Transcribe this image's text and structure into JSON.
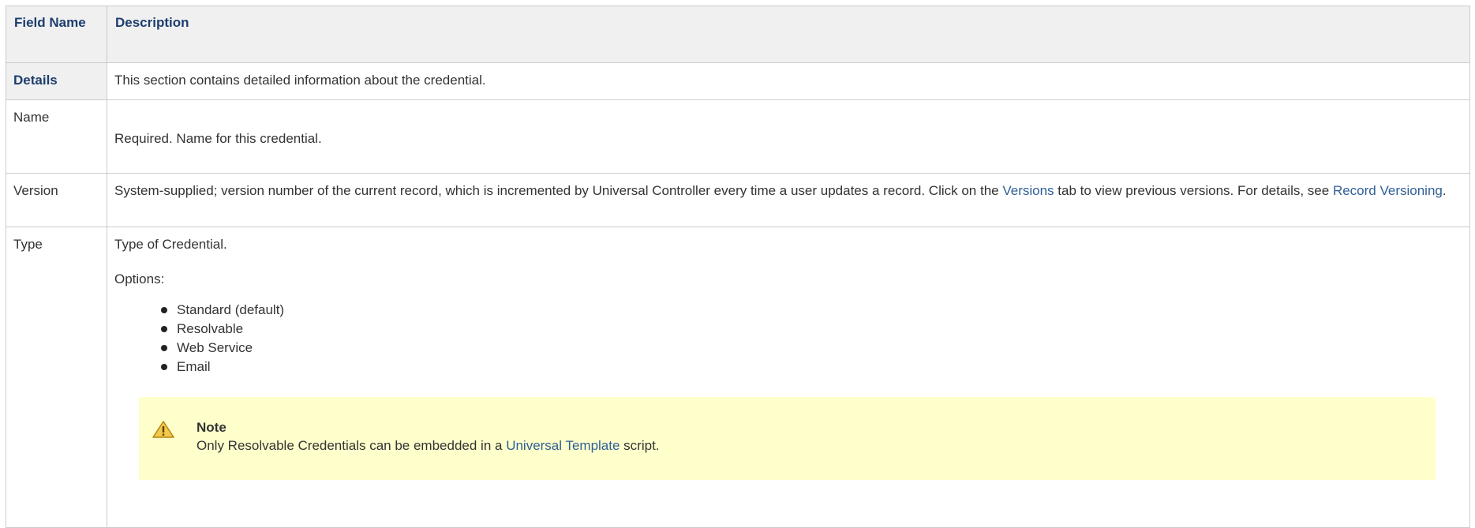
{
  "table": {
    "headers": {
      "field_name": "Field Name",
      "description": "Description"
    },
    "rows": {
      "details": {
        "field": "Details",
        "description": "This section contains detailed information about the credential."
      },
      "name": {
        "field": "Name",
        "description": "Required. Name for this credential."
      },
      "version": {
        "field": "Version",
        "text_before_link1": "System-supplied; version number of the current record, which is incremented by Universal Controller every time a user updates a record. Click on the ",
        "link1": "Versions",
        "text_between": " tab to view previous versions. For details, see ",
        "link2": "Record Versioning",
        "text_after": "."
      },
      "type": {
        "field": "Type",
        "intro": "Type of Credential.",
        "options_label": "Options:",
        "options": [
          "Standard (default)",
          "Resolvable",
          "Web Service",
          "Email"
        ],
        "note": {
          "icon": "warning-icon",
          "title": "Note",
          "text_before_link": "Only Resolvable Credentials can be embedded in a ",
          "link": "Universal Template",
          "text_after": " script."
        }
      }
    }
  },
  "colors": {
    "header_bg": "#f0f0f0",
    "header_text": "#1d3e6e",
    "link": "#2f5f97",
    "note_bg": "#ffffcc",
    "border": "#cccccc"
  }
}
